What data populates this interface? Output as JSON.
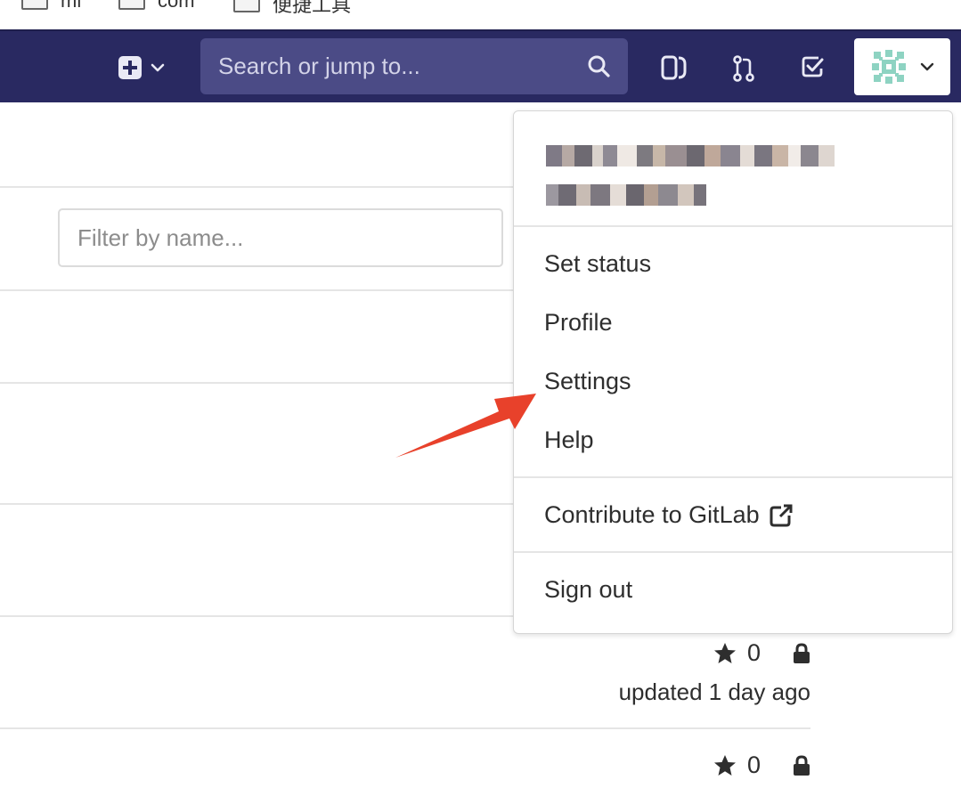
{
  "bookmarks": [
    {
      "label": "ml"
    },
    {
      "label": "com"
    },
    {
      "label": "便捷工具"
    }
  ],
  "navbar": {
    "search_placeholder": "Search or jump to...",
    "icons": [
      "plus-square-icon",
      "chevron-down-icon",
      "search-icon",
      "sidebar-toggle-icon",
      "merge-request-icon",
      "todo-check-icon",
      "identicon-avatar",
      "chevron-down-icon"
    ]
  },
  "content": {
    "filter_placeholder": "Filter by name...",
    "rows": [
      {
        "stars": "0",
        "updated": "updated 1 day ago"
      },
      {
        "stars": "0"
      }
    ]
  },
  "dropdown": {
    "items": [
      {
        "label": "Set status"
      },
      {
        "label": "Profile"
      },
      {
        "label": "Settings"
      },
      {
        "label": "Help"
      },
      {
        "label": "Contribute to GitLab"
      },
      {
        "label": "Sign out"
      }
    ]
  },
  "colors": {
    "navbar": "#292961",
    "search_bg": "#4b4b86",
    "annotation_arrow": "#e8412b"
  }
}
